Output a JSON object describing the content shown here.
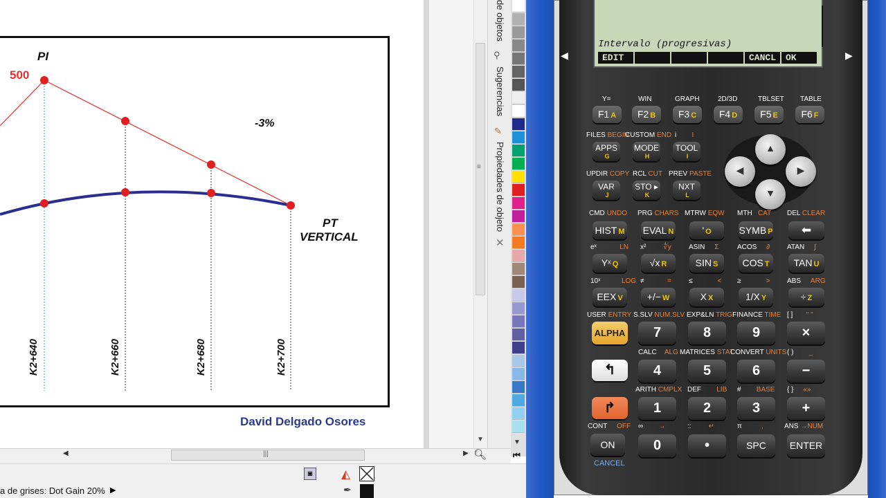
{
  "drawing": {
    "pi_label": "PI",
    "elevation_label": "500",
    "grade_label": "-3%",
    "pt_label_line1": "PT",
    "pt_label_line2": "VERTICAL",
    "stations": [
      "K2+640",
      "K2+660",
      "K2+680",
      "K2+700"
    ],
    "author": "David Delgado Osores",
    "colors": {
      "tangent": "#e03030",
      "curve": "#2a2f8f",
      "guide": "#2aa0d8"
    }
  },
  "docker_tabs": [
    "de objetos",
    "Sugerencias",
    "Propiedades de objeto"
  ],
  "palette_colors": [
    "#ffffff",
    "#b0b0b0",
    "#9a9a9a",
    "#888888",
    "#767676",
    "#646464",
    "#555555",
    "#eeeeee",
    "#ffffff",
    "#1e2a8c",
    "#1e90d8",
    "#00a070",
    "#00b050",
    "#ffe000",
    "#e02020",
    "#e0208c",
    "#c0209c",
    "#ff9050",
    "#f47a20",
    "#e8a8a8",
    "#a08878",
    "#7a6050",
    "#c8c8e8",
    "#9898d0",
    "#7878b8",
    "#6060a0",
    "#40408a",
    "#a8c8e8",
    "#88b8e8",
    "#3878c8",
    "#50a8e0",
    "#90d0f0",
    "#a8e0f0"
  ],
  "status": {
    "text": "a de grises: Dot Gain 20%"
  },
  "calculator": {
    "screen_line": "Intervalo (progresivas)",
    "softkeys": [
      "EDIT",
      "",
      "",
      "",
      "CANCL",
      "OK"
    ],
    "fkeys": [
      {
        "top": "Y=",
        "label": "F1",
        "alpha": "A"
      },
      {
        "top": "WIN",
        "label": "F2",
        "alpha": "B"
      },
      {
        "top": "GRAPH",
        "label": "F3",
        "alpha": "C"
      },
      {
        "top": "2D/3D",
        "label": "F4",
        "alpha": "D"
      },
      {
        "top": "TBLSET",
        "label": "F5",
        "alpha": "E"
      },
      {
        "top": "TABLE",
        "label": "F6",
        "alpha": "F"
      }
    ],
    "row2": [
      {
        "top": "FILES",
        "top2": "BEGIN",
        "label": "APPS",
        "alpha": "G"
      },
      {
        "top": "CUSTOM",
        "top2": "END",
        "label": "MODE",
        "alpha": "H"
      },
      {
        "top": "i",
        "top2": "I",
        "label": "TOOL",
        "alpha": "I"
      }
    ],
    "row3": [
      {
        "top": "UPDIR",
        "top2": "COPY",
        "label": "VAR",
        "alpha": "J"
      },
      {
        "top": "RCL",
        "top2": "CUT",
        "label": "STO ▸",
        "alpha": "K"
      },
      {
        "top": "PREV",
        "top2": "PASTE",
        "label": "NXT",
        "alpha": "L"
      }
    ],
    "row4": [
      {
        "top": "CMD",
        "top2": "UNDO",
        "label": "HIST",
        "alpha": "M"
      },
      {
        "top": "PRG",
        "top2": "CHARS",
        "label": "EVAL",
        "alpha": "N"
      },
      {
        "top": "MTRW",
        "top2": "EQW",
        "label": "'",
        "alpha": "O"
      },
      {
        "top": "MTH",
        "top2": "CAT",
        "label": "SYMB",
        "alpha": "P"
      },
      {
        "top": "DEL",
        "top2": "CLEAR",
        "label": "⬅",
        "alpha": ""
      }
    ],
    "row5": [
      {
        "top": "eˣ",
        "top2": "LN",
        "label": "Yˣ",
        "alpha": "Q"
      },
      {
        "top": "x²",
        "top2": "∜y",
        "label": "√x",
        "alpha": "R"
      },
      {
        "top": "ASIN",
        "top2": "Σ",
        "label": "SIN",
        "alpha": "S"
      },
      {
        "top": "ACOS",
        "top2": "∂",
        "label": "COS",
        "alpha": "T"
      },
      {
        "top": "ATAN",
        "top2": "∫",
        "label": "TAN",
        "alpha": "U"
      }
    ],
    "row6": [
      {
        "top": "10ˣ",
        "top2": "LOG",
        "label": "EEX",
        "alpha": "V"
      },
      {
        "top": "≠",
        "top2": "=",
        "label": "+/−",
        "alpha": "W"
      },
      {
        "top": "≤",
        "top2": "<",
        "label": "X",
        "alpha": "X"
      },
      {
        "top": "≥",
        "top2": ">",
        "label": "1/X",
        "alpha": "Y"
      },
      {
        "top": "ABS",
        "top2": "ARG",
        "label": "÷",
        "alpha": "Z"
      }
    ],
    "row7": [
      {
        "top": "USER",
        "top2": "ENTRY",
        "label": "ALPHA"
      },
      {
        "top": "S.SLV",
        "top2": "NUM.SLV",
        "label": "7"
      },
      {
        "top": "EXP&LN",
        "top2": "TRIG",
        "label": "8"
      },
      {
        "top": "FINANCE",
        "top2": "TIME",
        "label": "9"
      },
      {
        "top": "[ ]",
        "top2": "\" \"",
        "label": "×"
      }
    ],
    "row8": [
      {
        "top": "",
        "top2": "",
        "label": "↰"
      },
      {
        "top": "CALC",
        "top2": "ALG",
        "label": "4"
      },
      {
        "top": "MATRICES",
        "top2": "STAT",
        "label": "5"
      },
      {
        "top": "CONVERT",
        "top2": "UNITS",
        "label": "6"
      },
      {
        "top": "( )",
        "top2": "_",
        "label": "−"
      }
    ],
    "row9": [
      {
        "top": "",
        "top2": "",
        "label": "↱"
      },
      {
        "top": "ARITH",
        "top2": "CMPLX",
        "label": "1"
      },
      {
        "top": "DEF",
        "top2": "LIB",
        "label": "2"
      },
      {
        "top": "#",
        "top2": "BASE",
        "label": "3"
      },
      {
        "top": "{ }",
        "top2": "«»",
        "label": "+"
      }
    ],
    "row10": [
      {
        "top": "CONT",
        "top2": "OFF",
        "label": "ON"
      },
      {
        "top": "∞",
        "top2": "→",
        "label": "0"
      },
      {
        "top": "::",
        "top2": "↵",
        "label": "•"
      },
      {
        "top": "π",
        "top2": ",",
        "label": "SPC"
      },
      {
        "top": "ANS",
        "top2": "→NUM",
        "label": "ENTER"
      }
    ],
    "cancel_label": "CANCEL"
  }
}
